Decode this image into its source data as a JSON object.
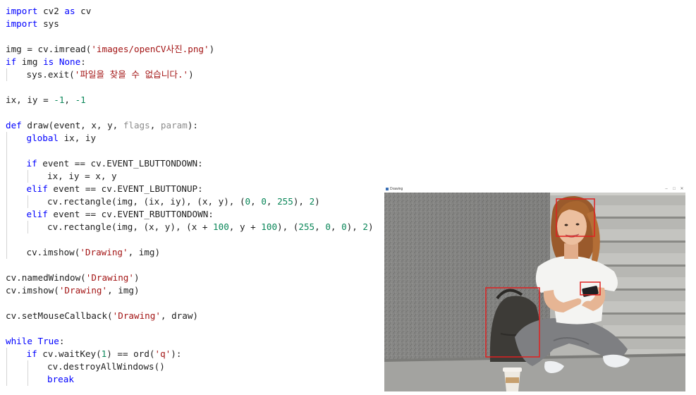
{
  "editor": {
    "lines": [
      {
        "indent": 0,
        "tokens": [
          {
            "t": "import",
            "c": "kw"
          },
          {
            "t": " cv2 "
          },
          {
            "t": "as",
            "c": "kw"
          },
          {
            "t": " cv"
          }
        ]
      },
      {
        "indent": 0,
        "tokens": [
          {
            "t": "import",
            "c": "kw"
          },
          {
            "t": " sys"
          }
        ]
      },
      {
        "indent": 0,
        "tokens": []
      },
      {
        "indent": 0,
        "tokens": [
          {
            "t": "img = cv.imread("
          },
          {
            "t": "'images/openCV사진.png'",
            "c": "str"
          },
          {
            "t": ")"
          }
        ]
      },
      {
        "indent": 0,
        "tokens": [
          {
            "t": "if",
            "c": "kw"
          },
          {
            "t": " img "
          },
          {
            "t": "is",
            "c": "kw"
          },
          {
            "t": " "
          },
          {
            "t": "None",
            "c": "kw"
          },
          {
            "t": ":"
          }
        ]
      },
      {
        "indent": 1,
        "tokens": [
          {
            "t": "sys.exit("
          },
          {
            "t": "'파일을 찾을 수 없습니다.'",
            "c": "str"
          },
          {
            "t": ")"
          }
        ]
      },
      {
        "indent": 0,
        "tokens": []
      },
      {
        "indent": 0,
        "tokens": [
          {
            "t": "ix, iy = "
          },
          {
            "t": "-1",
            "c": "num"
          },
          {
            "t": ", "
          },
          {
            "t": "-1",
            "c": "num"
          }
        ]
      },
      {
        "indent": 0,
        "tokens": []
      },
      {
        "indent": 0,
        "tokens": [
          {
            "t": "def",
            "c": "kw"
          },
          {
            "t": " draw(event, x, y, "
          },
          {
            "t": "flags",
            "c": "dim"
          },
          {
            "t": ", "
          },
          {
            "t": "param",
            "c": "dim"
          },
          {
            "t": "):"
          }
        ]
      },
      {
        "indent": 1,
        "tokens": [
          {
            "t": "global",
            "c": "kw"
          },
          {
            "t": " ix, iy"
          }
        ]
      },
      {
        "indent": 1,
        "tokens": []
      },
      {
        "indent": 1,
        "tokens": [
          {
            "t": "if",
            "c": "kw"
          },
          {
            "t": " event == cv.EVENT_LBUTTONDOWN:"
          }
        ]
      },
      {
        "indent": 2,
        "tokens": [
          {
            "t": "ix, iy = x, y"
          }
        ]
      },
      {
        "indent": 1,
        "tokens": [
          {
            "t": "elif",
            "c": "kw"
          },
          {
            "t": " event == cv.EVENT_LBUTTONUP:"
          }
        ]
      },
      {
        "indent": 2,
        "tokens": [
          {
            "t": "cv.rectangle(img, (ix, iy), (x, y), ("
          },
          {
            "t": "0",
            "c": "num"
          },
          {
            "t": ", "
          },
          {
            "t": "0",
            "c": "num"
          },
          {
            "t": ", "
          },
          {
            "t": "255",
            "c": "num"
          },
          {
            "t": "), "
          },
          {
            "t": "2",
            "c": "num"
          },
          {
            "t": ")"
          }
        ]
      },
      {
        "indent": 1,
        "tokens": [
          {
            "t": "elif",
            "c": "kw"
          },
          {
            "t": " event == cv.EVENT_RBUTTONDOWN:"
          }
        ]
      },
      {
        "indent": 2,
        "tokens": [
          {
            "t": "cv.rectangle(img, (x, y), (x + "
          },
          {
            "t": "100",
            "c": "num"
          },
          {
            "t": ", y + "
          },
          {
            "t": "100",
            "c": "num"
          },
          {
            "t": "), ("
          },
          {
            "t": "255",
            "c": "num"
          },
          {
            "t": ", "
          },
          {
            "t": "0",
            "c": "num"
          },
          {
            "t": ", "
          },
          {
            "t": "0",
            "c": "num"
          },
          {
            "t": "), "
          },
          {
            "t": "2",
            "c": "num"
          },
          {
            "t": ")"
          }
        ]
      },
      {
        "indent": 1,
        "tokens": []
      },
      {
        "indent": 1,
        "tokens": [
          {
            "t": "cv.imshow("
          },
          {
            "t": "'Drawing'",
            "c": "str"
          },
          {
            "t": ", img)"
          }
        ]
      },
      {
        "indent": 0,
        "tokens": []
      },
      {
        "indent": 0,
        "tokens": [
          {
            "t": "cv.namedWindow("
          },
          {
            "t": "'Drawing'",
            "c": "str"
          },
          {
            "t": ")"
          }
        ]
      },
      {
        "indent": 0,
        "tokens": [
          {
            "t": "cv.imshow("
          },
          {
            "t": "'Drawing'",
            "c": "str"
          },
          {
            "t": ", img)"
          }
        ]
      },
      {
        "indent": 0,
        "tokens": []
      },
      {
        "indent": 0,
        "tokens": [
          {
            "t": "cv.setMouseCallback("
          },
          {
            "t": "'Drawing'",
            "c": "str"
          },
          {
            "t": ", draw)"
          }
        ]
      },
      {
        "indent": 0,
        "tokens": []
      },
      {
        "indent": 0,
        "tokens": [
          {
            "t": "while",
            "c": "kw"
          },
          {
            "t": " "
          },
          {
            "t": "True",
            "c": "kw"
          },
          {
            "t": ":"
          }
        ]
      },
      {
        "indent": 1,
        "tokens": [
          {
            "t": "if",
            "c": "kw"
          },
          {
            "t": " cv.waitKey("
          },
          {
            "t": "1",
            "c": "num"
          },
          {
            "t": ") == ord("
          },
          {
            "t": "'q'",
            "c": "str"
          },
          {
            "t": "):"
          }
        ]
      },
      {
        "indent": 2,
        "tokens": [
          {
            "t": "cv.destroyAllWindows()"
          }
        ]
      },
      {
        "indent": 2,
        "tokens": [
          {
            "t": "break",
            "c": "kw"
          }
        ]
      }
    ]
  },
  "drawing_window": {
    "title": "Drawing",
    "icon": "app-window-icon",
    "controls": [
      "minimize-icon",
      "maximize-icon",
      "close-icon"
    ],
    "rectangle_color": "#e02020"
  },
  "colors": {
    "keyword": "#0000ff",
    "string": "#a31515",
    "number": "#098658",
    "dim_param": "#8c8c8c"
  }
}
